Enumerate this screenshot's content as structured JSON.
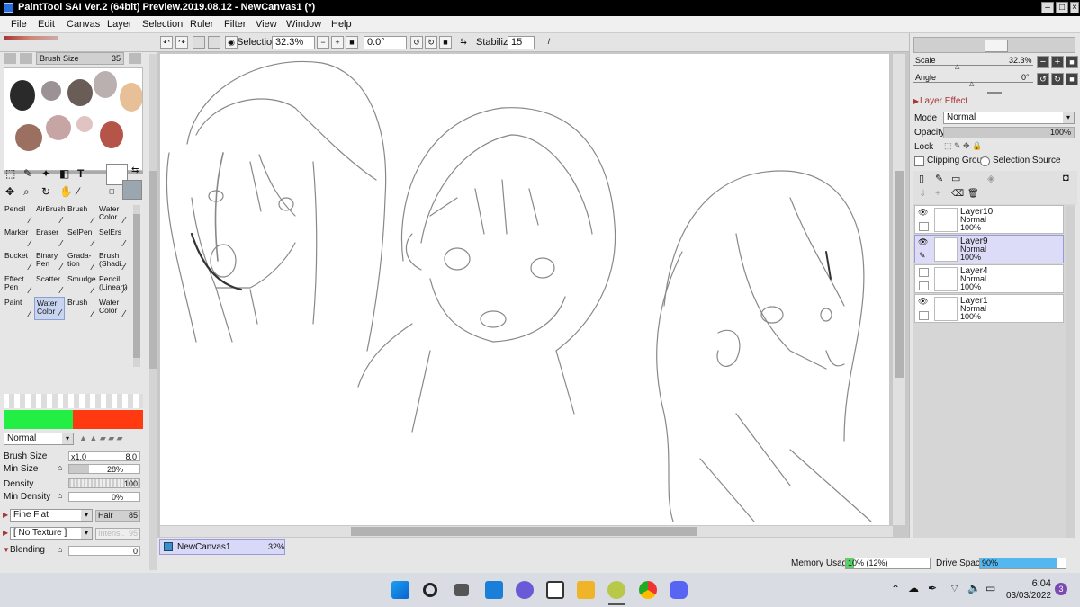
{
  "window": {
    "title": "PaintTool SAI Ver.2 (64bit) Preview.2019.08.12 - NewCanvas1 (*)"
  },
  "menu": [
    "File",
    "Edit",
    "Canvas",
    "Layer",
    "Selection",
    "Ruler",
    "Filter",
    "View",
    "Window",
    "Help"
  ],
  "toolbar": {
    "selection_label": "Selection",
    "zoom": "32.3%",
    "angle": "0.0°",
    "stabilizer_label": "Stabilizer",
    "stabilizer_value": "15"
  },
  "brush_size_top": {
    "label": "Brush Size",
    "value": "35"
  },
  "tools": [
    {
      "l1": "Pencil",
      "l2": ""
    },
    {
      "l1": "AirBrush",
      "l2": ""
    },
    {
      "l1": "Brush",
      "l2": ""
    },
    {
      "l1": "Water",
      "l2": "Color"
    },
    {
      "l1": "Marker",
      "l2": ""
    },
    {
      "l1": "Eraser",
      "l2": ""
    },
    {
      "l1": "SelPen",
      "l2": ""
    },
    {
      "l1": "SelErs",
      "l2": ""
    },
    {
      "l1": "Bucket",
      "l2": ""
    },
    {
      "l1": "Binary",
      "l2": "Pen"
    },
    {
      "l1": "Grada-",
      "l2": "tion"
    },
    {
      "l1": "Brush",
      "l2": "(Shadi.."
    },
    {
      "l1": "Effect",
      "l2": "Pen"
    },
    {
      "l1": "Scatter",
      "l2": ""
    },
    {
      "l1": "Smudge",
      "l2": ""
    },
    {
      "l1": "Pencil",
      "l2": "(Lineart)"
    },
    {
      "l1": "Paint",
      "l2": ""
    },
    {
      "l1": "Water",
      "l2": "Color"
    },
    {
      "l1": "Brush",
      "l2": ""
    },
    {
      "l1": "Water",
      "l2": "Color"
    }
  ],
  "brush": {
    "blend_mode": "Normal",
    "size_label": "Brush Size",
    "size_mult": "x1.0",
    "size_value": "8.0",
    "min_size_label": "Min Size",
    "min_size_value": "28%",
    "min_size_level": 0.28,
    "density_label": "Density",
    "density_value": "100",
    "min_density_label": "Min Density",
    "min_density_value": "0%",
    "shape": "Fine Flat",
    "shape2": "Hair",
    "shape2_value": "85",
    "texture": "[ No Texture ]",
    "texture2": "Intens..",
    "texture2_value": "95",
    "blending_label": "Blending",
    "blending_value": "0"
  },
  "colors": {
    "fg": "#ffffff",
    "bg": "#9aa7b0",
    "green": "#22ee44",
    "orange": "#ff3a10"
  },
  "navigator": {
    "scale_label": "Scale",
    "scale_value": "32.3%",
    "angle_label": "Angle",
    "angle_value": "0°"
  },
  "layer_panel": {
    "effect_label": "Layer Effect",
    "mode_label": "Mode",
    "mode_value": "Normal",
    "opacity_label": "Opacity",
    "opacity_value": "100%",
    "lock_label": "Lock",
    "clipping_label": "Clipping Group",
    "selection_source_label": "Selection Source",
    "layers": [
      {
        "name": "Layer10",
        "mode": "Normal",
        "opacity": "100%"
      },
      {
        "name": "Layer9",
        "mode": "Normal",
        "opacity": "100%"
      },
      {
        "name": "Layer4",
        "mode": "Normal",
        "opacity": "100%"
      },
      {
        "name": "Layer1",
        "mode": "Normal",
        "opacity": "100%"
      }
    ]
  },
  "status": {
    "tab_name": "NewCanvas1",
    "tab_zoom": "32%",
    "memory_label": "Memory Usage",
    "memory_value": "10% (12%)",
    "memory_level": 0.1,
    "drive_label": "Drive Space",
    "drive_value": "90%",
    "drive_level": 0.9
  },
  "taskbar": {
    "time": "6:04",
    "date": "03/03/2022",
    "notif": "3"
  }
}
